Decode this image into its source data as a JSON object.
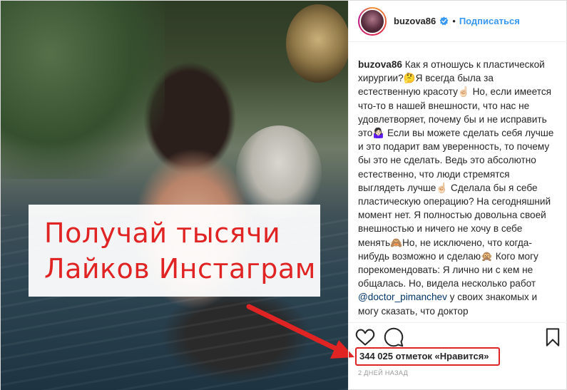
{
  "promo": {
    "line1": "Получай тысячи",
    "line2": "Лайков Инстаграм"
  },
  "header": {
    "username": "buzova86",
    "separator": "•",
    "follow_label": "Подписаться"
  },
  "caption": {
    "username": "buzova86",
    "part1": " Как я отношусь к пластической хирургии?🤔Я всегда была за естественную красоту☝🏻 Но, если имеется что-то в нашей внешности, что нас не удовлетворяет, почему бы и не исправить это🤷🏻‍♀️ Если вы можете сделать себя лучше и это подарит вам уверенность, то почему бы это не сделать. Ведь это абсолютно естественно, что люди стремятся выглядеть лучше☝🏻 Сделала бы я себе пластическую операцию? На сегодняшний момент нет. Я полностью довольна своей внешностью и ничего не хочу в себе менять🙈Но, не исключено, что когда-нибудь возможно и сделаю🙊 Кого могу порекомендовать: Я лично ни с кем не общалась. Но, видела несколько работ ",
    "mention": "@doctor_pimanchev",
    "part2": " у своих знакомых и могу сказать, что доктор"
  },
  "likes": {
    "text": "344 025 отметок «Нравится»"
  },
  "timestamp": "2 дней назад",
  "colors": {
    "accent_red": "#e02424",
    "follow_blue": "#3897f0",
    "verified_blue": "#3897f0"
  },
  "icons": [
    "heart-icon",
    "comment-icon",
    "bookmark-icon",
    "verified-icon"
  ]
}
